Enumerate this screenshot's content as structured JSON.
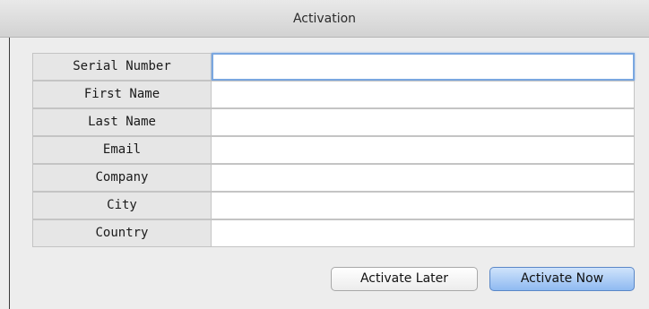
{
  "window": {
    "title": "Activation"
  },
  "form": {
    "fields": [
      {
        "label": "Serial Number",
        "value": "",
        "focused": true
      },
      {
        "label": "First Name",
        "value": ""
      },
      {
        "label": "Last Name",
        "value": ""
      },
      {
        "label": "Email",
        "value": ""
      },
      {
        "label": "Company",
        "value": ""
      },
      {
        "label": "City",
        "value": ""
      },
      {
        "label": "Country",
        "value": ""
      }
    ]
  },
  "buttons": {
    "later_label": "Activate Later",
    "now_label": "Activate Now"
  },
  "colors": {
    "focus_ring": "#7aa7e0",
    "default_button": "#8fbaf1"
  }
}
